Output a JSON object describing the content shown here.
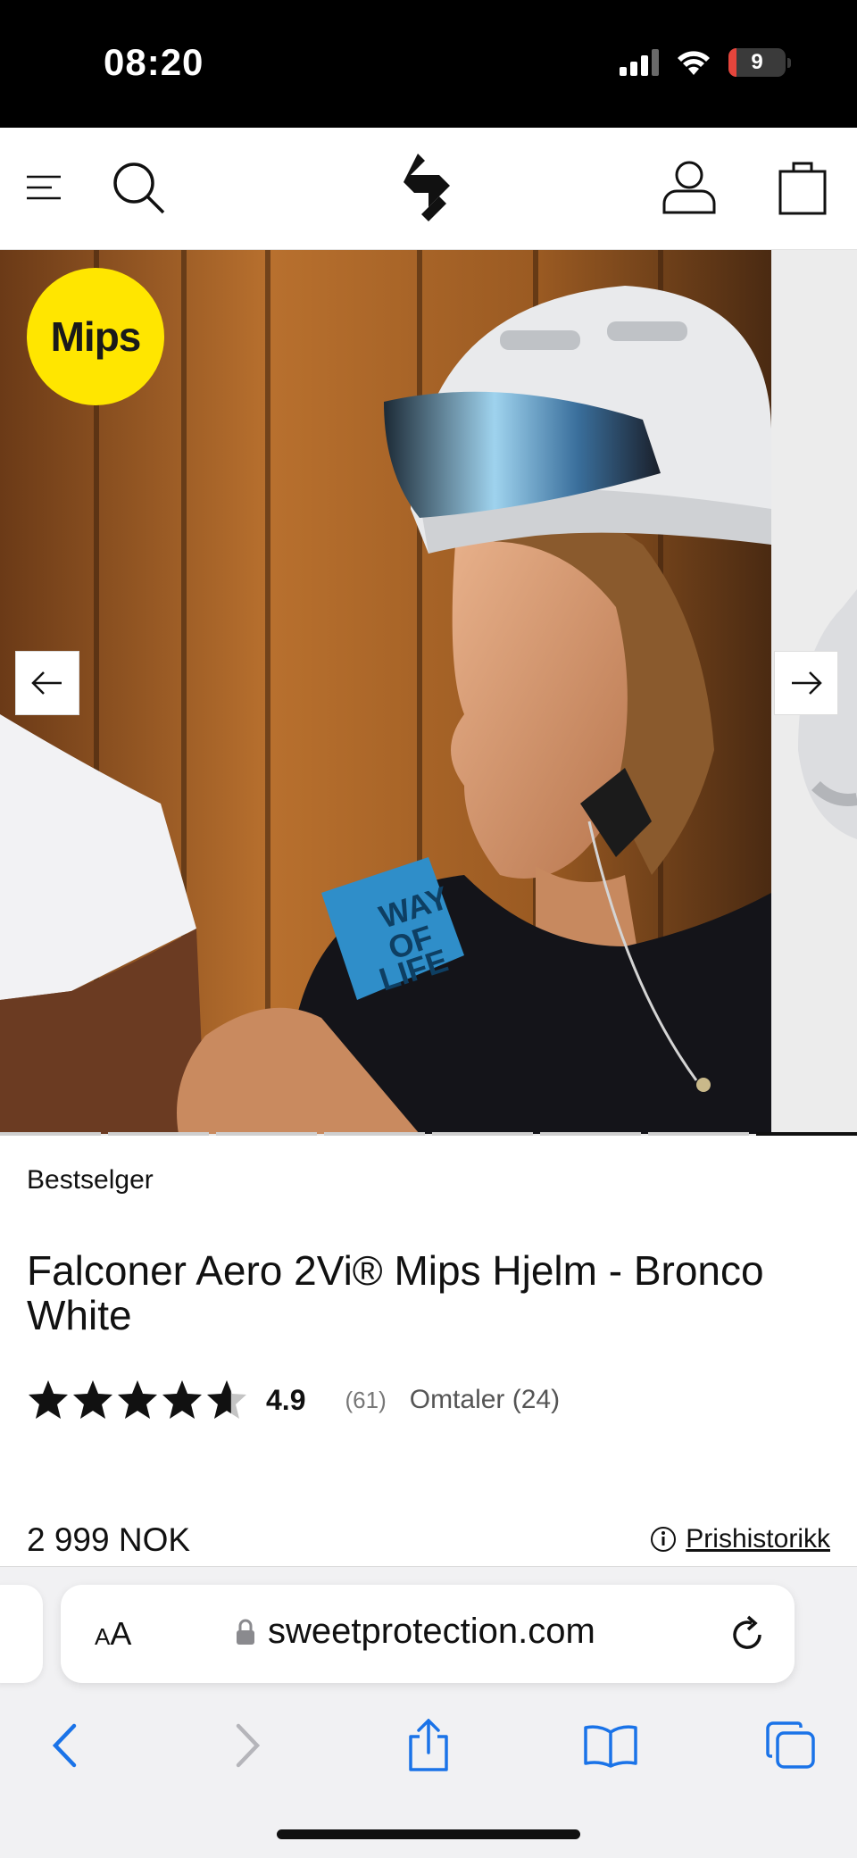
{
  "status_bar": {
    "time": "08:20",
    "battery": "9"
  },
  "header": {
    "menu_icon": "hamburger-menu-icon",
    "search_icon": "search-icon",
    "logo": "sweet-protection-logo",
    "account_icon": "user-icon",
    "cart_icon": "shopping-bag-icon"
  },
  "carousel": {
    "badge": "Mips",
    "prev_icon": "arrow-left-icon",
    "next_icon": "arrow-right-icon",
    "slide_count": 8,
    "active_slide": 8,
    "tshirt_text": "WAY OF LIFE"
  },
  "product": {
    "badge": "Bestselger",
    "title": "Falconer Aero 2Vi® Mips Hjelm - Bronco White",
    "rating": "4.9",
    "rating_value": 4.9,
    "rating_count": "(61)",
    "reviews_label": "Omtaler (24)",
    "price": "2 999 NOK",
    "price_history_label": "Prishistorikk"
  },
  "browser": {
    "text_size_label_small": "A",
    "text_size_label_large": "A",
    "url": "sweetprotection.com",
    "colors": {
      "accent": "#1a73e8",
      "disabled": "#b5b5ba"
    }
  }
}
